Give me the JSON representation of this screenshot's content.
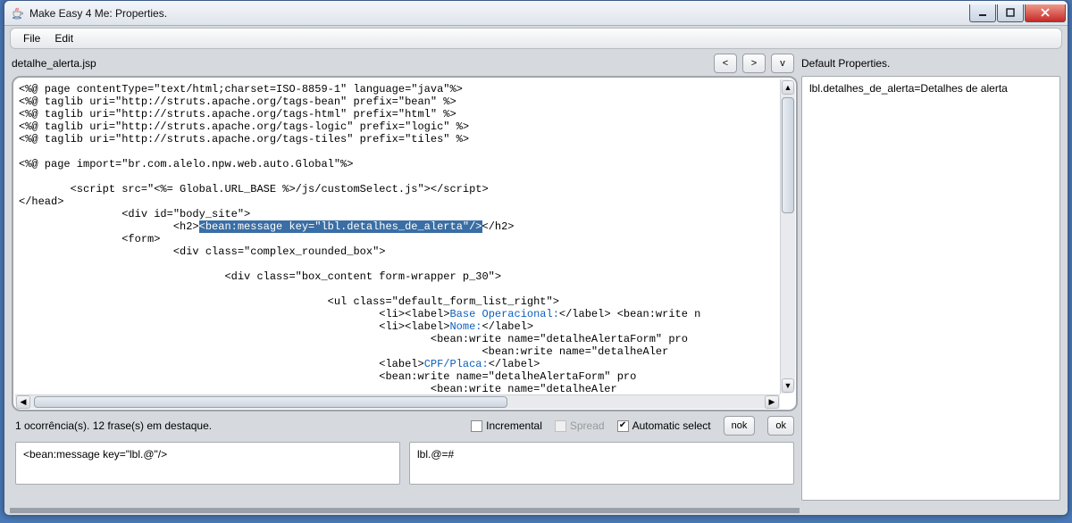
{
  "window": {
    "title": "Make Easy 4 Me: Properties."
  },
  "menubar": {
    "items": [
      "File",
      "Edit"
    ]
  },
  "file": {
    "name": "detalhe_alerta.jsp"
  },
  "nav": {
    "back": "<",
    "forward": ">",
    "dropdown": "v"
  },
  "code": {
    "l1": "<%@ page contentType=\"text/html;charset=ISO-8859-1\" language=\"java\"%>",
    "l2": "<%@ taglib uri=\"http://struts.apache.org/tags-bean\" prefix=\"bean\" %>",
    "l3": "<%@ taglib uri=\"http://struts.apache.org/tags-html\" prefix=\"html\" %>",
    "l4": "<%@ taglib uri=\"http://struts.apache.org/tags-logic\" prefix=\"logic\" %>",
    "l5": "<%@ taglib uri=\"http://struts.apache.org/tags-tiles\" prefix=\"tiles\" %>",
    "l6": "",
    "l7": "<%@ page import=\"br.com.alelo.npw.web.auto.Global\"%>",
    "l8": "",
    "l9": "        <script src=\"<%= Global.URL_BASE %>/js/customSelect.js\"></script>",
    "l10": "</head>",
    "l11": "                <div id=\"body_site\">",
    "l12a": "                        <h2>",
    "l12h": "<bean:message key=\"lbl.detalhes_de_alerta\"/>",
    "l12b": "</h2>",
    "l13": "                <form>",
    "l14": "                        <div class=\"complex_rounded_box\">",
    "l15": "",
    "l16": "                                <div class=\"box_content form-wrapper p_30\">",
    "l17": "",
    "l18": "                                                <ul class=\"default_form_list_right\">",
    "l19a": "                                                        <li><label>",
    "l19k": "Base Operacional:",
    "l19b": "</label> <bean:write n",
    "l20a": "                                                        <li><label>",
    "l20k": "Nome:",
    "l20b": "</label>",
    "l21": "                                                                <bean:write name=\"detalheAlertaForm\" pro",
    "l22": "                                                                        <bean:write name=\"detalheAler",
    "l23a": "                                                        <label>",
    "l23k": "CPF/Placa:",
    "l23b": "</label>",
    "l24": "                                                        <bean:write name=\"detalheAlertaForm\" pro",
    "l25": "                                                                <bean:write name=\"detalheAler"
  },
  "options": {
    "status": "1 ocorrência(s). 12 frase(s) em destaque.",
    "incremental_label": "Incremental",
    "incremental_checked": false,
    "spread_label": "Spread",
    "spread_checked": false,
    "spread_disabled": true,
    "automatic_label": "Automatic select",
    "automatic_checked": true,
    "nok_label": "nok",
    "ok_label": "ok"
  },
  "inputs": {
    "pattern": "<bean:message key=\"lbl.@\"/>",
    "replacement": "lbl.@=#"
  },
  "right": {
    "title": "Default Properties.",
    "content": "lbl.detalhes_de_alerta=Detalhes de alerta"
  }
}
